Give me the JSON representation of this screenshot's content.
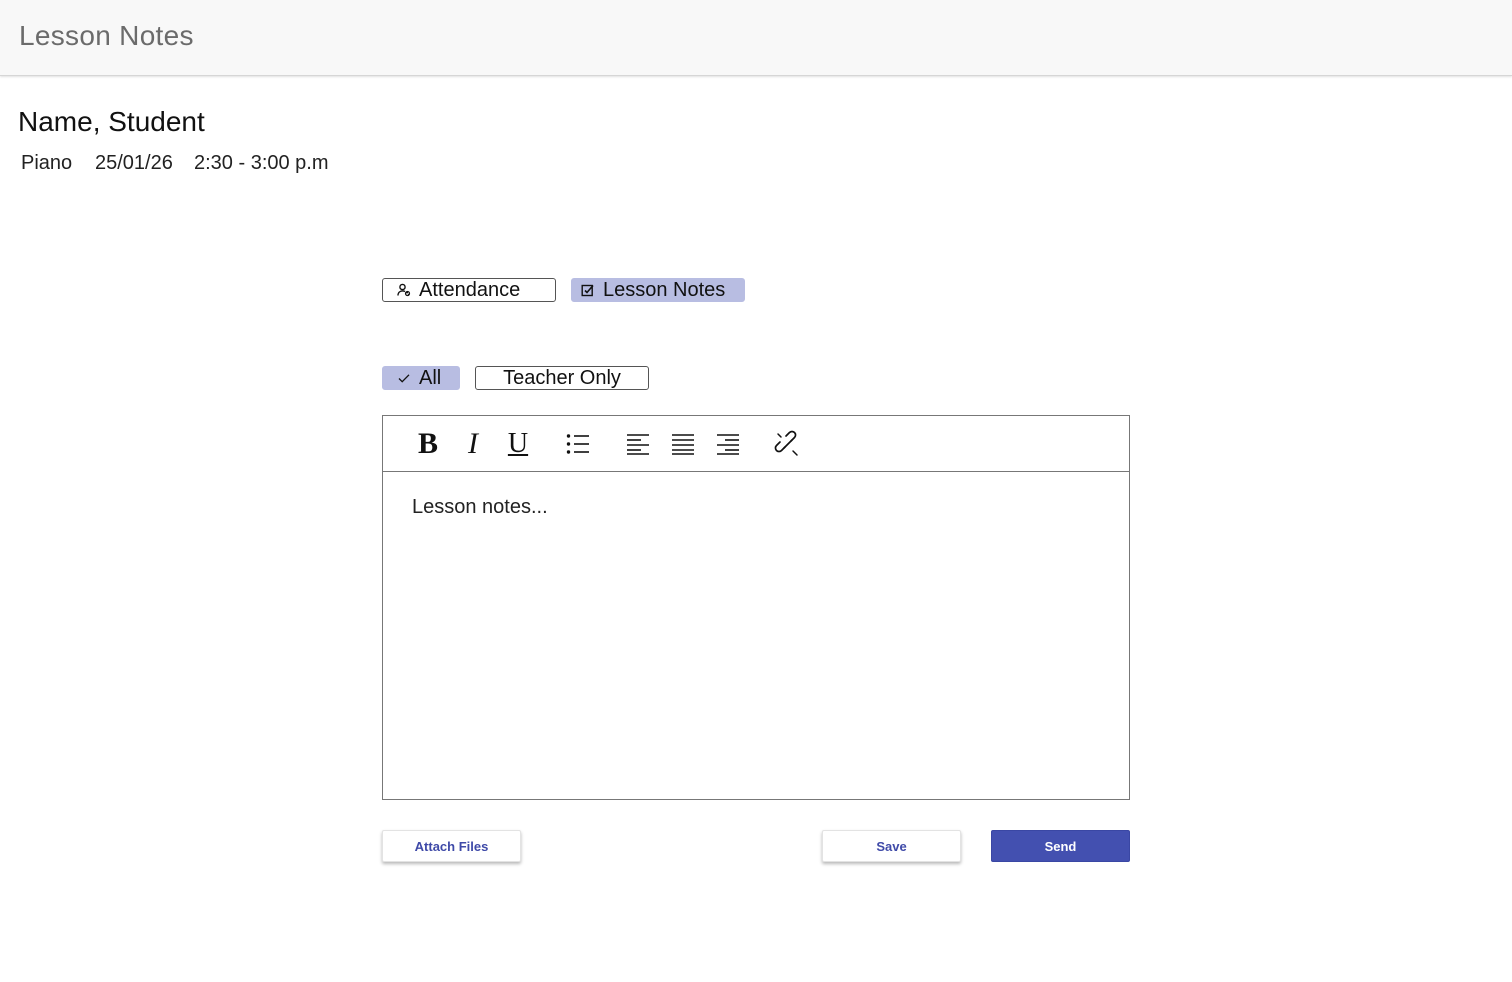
{
  "header": {
    "title": "Lesson Notes"
  },
  "student": {
    "name": "Name, Student",
    "subject": "Piano",
    "date": "25/01/26",
    "time": "2:30 - 3:00 p.m"
  },
  "tabs": [
    {
      "label": "Attendance",
      "icon": "person-check-icon",
      "active": false
    },
    {
      "label": "Lesson Notes",
      "icon": "edit-note-icon",
      "active": true
    }
  ],
  "visibility": [
    {
      "label": "All",
      "icon": "check-icon",
      "selected": true
    },
    {
      "label": "Teacher Only",
      "selected": false
    }
  ],
  "toolbar": {
    "bold": "B",
    "italic": "I",
    "underline": "U",
    "tools": [
      "bold-icon",
      "italic-icon",
      "underline-icon",
      "bullet-list-icon",
      "align-left-icon",
      "align-justify-icon",
      "align-right-icon",
      "link-icon"
    ]
  },
  "editor": {
    "placeholder": "Lesson notes..."
  },
  "actions": {
    "attach_label": "Attach Files",
    "save_label": "Save",
    "send_label": "Send"
  },
  "colors": {
    "accent": "#4350b0",
    "chip_active": "#b8bde2",
    "header_bg": "#f8f8f8"
  }
}
